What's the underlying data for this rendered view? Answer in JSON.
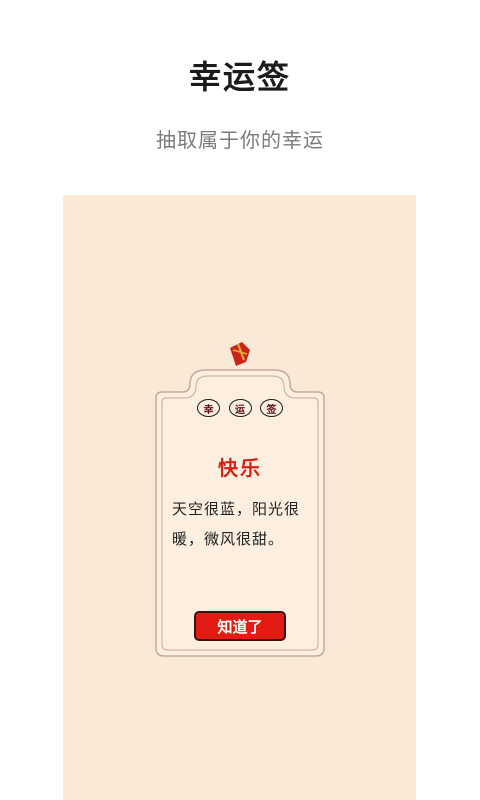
{
  "header": {
    "title": "幸运签",
    "subtitle": "抽取属于你的幸运"
  },
  "card": {
    "chips": [
      "幸",
      "运",
      "签"
    ],
    "title": "快乐",
    "message": "天空很蓝，阳光很暖，微风很甜。",
    "button_label": "知道了"
  },
  "colors": {
    "panel_bg": "#f9e9d6",
    "accent_red": "#e41b12",
    "title_red": "#d42216",
    "card_border": "#c9a89a"
  }
}
